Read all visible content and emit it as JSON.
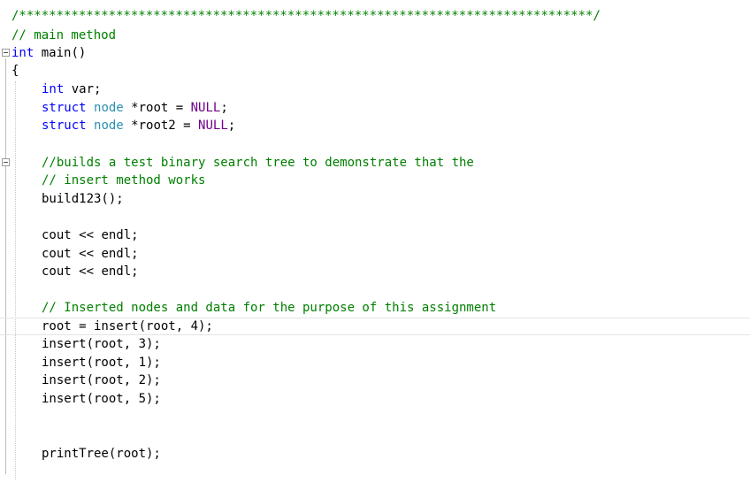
{
  "lines": {
    "l1": {
      "a": "/*****************************************************************************/"
    },
    "l2": {
      "a": "// main method"
    },
    "l3": {
      "a": "int",
      "b": " main()"
    },
    "l4": {
      "a": "{"
    },
    "l5": {
      "a": "int",
      "b": " var;"
    },
    "l6": {
      "a": "struct",
      "b": " ",
      "c": "node",
      "d": " *root = ",
      "e": "NULL",
      "f": ";"
    },
    "l7": {
      "a": "struct",
      "b": " ",
      "c": "node",
      "d": " *root2 = ",
      "e": "NULL",
      "f": ";"
    },
    "l8": {
      "a": "//builds a test binary search tree to demonstrate that the"
    },
    "l9": {
      "a": "// insert method works"
    },
    "l10": {
      "a": "build123();"
    },
    "l11": {
      "a": "cout ",
      "b": "<<",
      "c": " endl;"
    },
    "l12": {
      "a": "cout ",
      "b": "<<",
      "c": " endl;"
    },
    "l13": {
      "a": "cout ",
      "b": "<<",
      "c": " endl;"
    },
    "l14": {
      "a": "// Inserted nodes and data for the purpose of this assignment"
    },
    "l15": {
      "a": "root = insert(root, 4);"
    },
    "l16": {
      "a": "insert(root, 3);"
    },
    "l17": {
      "a": "insert(root, 1);"
    },
    "l18": {
      "a": "insert(root, 2);"
    },
    "l19": {
      "a": "insert(root, 5);"
    },
    "l20": {
      "a": "printTree(root);"
    }
  },
  "colors": {
    "comment": "#008000",
    "keyword": "#0000ff",
    "type": "#2b91af",
    "macro": "#6f008a",
    "text": "#000000"
  },
  "icons": [
    "collapse-icon"
  ]
}
